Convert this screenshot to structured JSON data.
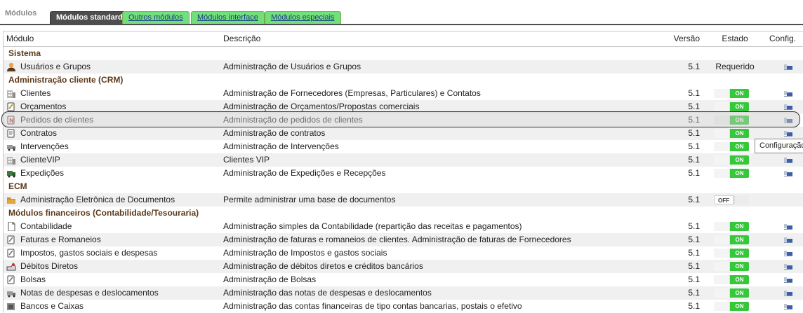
{
  "page_title": "Módulos",
  "tabs": [
    {
      "label": "Módulos standard",
      "active": true
    },
    {
      "label": "Outros módulos",
      "active": false
    },
    {
      "label": "Módulos interface",
      "active": false
    },
    {
      "label": "Módulos especiais",
      "active": false
    }
  ],
  "table": {
    "headers": {
      "module": "Módulo",
      "description": "Descrição",
      "version": "Versão",
      "state": "Estado",
      "config": "Config."
    },
    "groups": [
      {
        "title": "Sistema",
        "rows": [
          {
            "icon": "users-icon",
            "module": "Usuários e Grupos",
            "description": "Administração de Usuários e Grupos",
            "version": "5.1",
            "state": "required",
            "state_label": "Requerido",
            "config": true
          }
        ]
      },
      {
        "title": "Administração cliente (CRM)",
        "rows": [
          {
            "icon": "building-icon",
            "module": "Clientes",
            "description": "Administração de Fornecedores (Empresas, Particulares) e Contatos",
            "version": "5.1",
            "state": "on",
            "state_label": "ON",
            "config": true
          },
          {
            "icon": "proposal-icon",
            "module": "Orçamentos",
            "description": "Administração de Orçamentos/Propostas comerciais",
            "version": "5.1",
            "state": "on",
            "state_label": "ON",
            "config": true
          },
          {
            "icon": "order-icon",
            "module": "Pedidos de clientes",
            "description": "Administração de pedidos de clientes",
            "version": "5.1",
            "state": "on",
            "state_label": "ON",
            "config": true,
            "highlighted": true
          },
          {
            "icon": "contract-icon",
            "module": "Contratos",
            "description": "Administração de contratos",
            "version": "5.1",
            "state": "on",
            "state_label": "ON",
            "config": true
          },
          {
            "icon": "truck-icon",
            "module": "Intervenções",
            "description": "Administração de Intervenções",
            "version": "5.1",
            "state": "on",
            "state_label": "ON",
            "config": true
          },
          {
            "icon": "building-icon",
            "module": "ClienteVIP",
            "description": "Clientes VIP",
            "version": "5.1",
            "state": "on",
            "state_label": "ON",
            "config": true
          },
          {
            "icon": "shipment-icon",
            "module": "Expedições",
            "description": "Administração de Expedições e Recepções",
            "version": "5.1",
            "state": "on",
            "state_label": "ON",
            "config": true
          }
        ]
      },
      {
        "title": "ECM",
        "rows": [
          {
            "icon": "folder-icon",
            "module": "Administração Eletrônica de Documentos",
            "description": "Permite administrar uma base de documentos",
            "version": "5.1",
            "state": "off",
            "state_label": "OFF",
            "config": false
          }
        ]
      },
      {
        "title": "Módulos financeiros (Contabilidade/Tesouraria)",
        "rows": [
          {
            "icon": "document-icon",
            "module": "Contabilidade",
            "description": "Administração simples da Contabilidade (repartição das receitas e pagamentos)",
            "version": "5.1",
            "state": "on",
            "state_label": "ON",
            "config": true
          },
          {
            "icon": "invoice-icon",
            "module": "Faturas e Romaneios",
            "description": "Administração de faturas e romaneios de clientes. Administração de faturas de Fornecedores",
            "version": "5.1",
            "state": "on",
            "state_label": "ON",
            "config": true
          },
          {
            "icon": "invoice-icon",
            "module": "Impostos, gastos sociais e despesas",
            "description": "Administração de Impostos e gastos sociais",
            "version": "5.1",
            "state": "on",
            "state_label": "ON",
            "config": true
          },
          {
            "icon": "direct-debit-icon",
            "module": "Débitos Diretos",
            "description": "Administração de débitos diretos e créditos bancários",
            "version": "5.1",
            "state": "on",
            "state_label": "ON",
            "config": true
          },
          {
            "icon": "invoice-icon",
            "module": "Bolsas",
            "description": "Administração de Bolsas",
            "version": "5.1",
            "state": "on",
            "state_label": "ON",
            "config": true
          },
          {
            "icon": "truck-icon",
            "module": "Notas de despesas e deslocamentos",
            "description": "Administração das notas de despesas e deslocamentos",
            "version": "5.1",
            "state": "on",
            "state_label": "ON",
            "config": true
          },
          {
            "icon": "bank-icon",
            "module": "Bancos e Caixas",
            "description": "Administração das contas financeiras de tipo contas bancarias, postais o efetivo",
            "version": "5.1",
            "state": "on",
            "state_label": "ON",
            "config": true
          }
        ]
      }
    ]
  },
  "tooltip": "Configuração",
  "colors": {
    "toggle_on": "#36c83a",
    "group_title": "#5c3a1a",
    "tab_inactive": "#72e07a",
    "tab_active": "#4e4e4e"
  }
}
